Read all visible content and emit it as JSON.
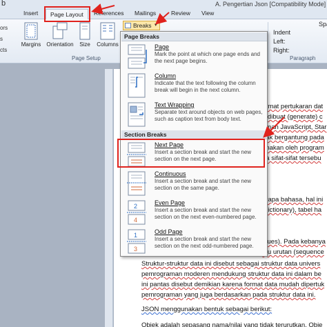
{
  "window": {
    "title": "A. Pengertian Json [Compatibility Mode] -",
    "app_glyph": "b"
  },
  "tabs": [
    {
      "label": "Insert"
    },
    {
      "label": "Page Layout",
      "active": true
    },
    {
      "label": "References"
    },
    {
      "label": "Mailings"
    },
    {
      "label": "Review"
    },
    {
      "label": "View"
    }
  ],
  "left_strip": [
    "ors",
    "s",
    "cts"
  ],
  "ribbon": {
    "margins": "Margins",
    "orientation": "Orientation",
    "size": "Size",
    "columns": "Columns",
    "page_setup": "Page Setup",
    "breaks": "Breaks",
    "indent": "Indent",
    "left": "Left:",
    "right": "Right:",
    "paragraph": "Paragraph",
    "spacing": "Spa"
  },
  "menu": {
    "page_breaks_header": "Page Breaks",
    "section_breaks_header": "Section Breaks",
    "items": [
      {
        "title": "Page",
        "desc": "Mark the point at which one page ends and the next page begins."
      },
      {
        "title": "Column",
        "desc": "Indicate that the text following the column break will begin in the next column."
      },
      {
        "title": "Text Wrapping",
        "desc": "Separate text around objects on web pages, such as caption text from body text."
      },
      {
        "title": "Next Page",
        "desc": "Insert a section break and start the new section on the next page."
      },
      {
        "title": "Continuous",
        "desc": "Insert a section break and start the new section on the same page."
      },
      {
        "title": "Even Page",
        "desc": "Insert a section break and start the new section on the next even-numbered page."
      },
      {
        "title": "Odd Page",
        "desc": "Insert a section break and start the new section on the next odd-numbered page."
      }
    ]
  },
  "document": {
    "lines": [
      "ormat pertukaran dat",
      "n dibuat (generate) c",
      "aman JavaScript, Star",
      "dak bergantung pada",
      "unakan oleh program",
      "na sifat-sifat tersebu",
      "erapa bahasa, hal ini",
      "(dictionary), tabel ha",
      "alues). Pada kebanya",
      "tau urutan (sequence",
      "Struktur-struktur data ini disebut sebagai struktur data univers",
      "pemrograman moderen mendukung struktur data ini dalam be",
      "ini pantas disebut demikian karena format data mudah dipertuk",
      "pemrograman yang juga berdasarkan pada struktur data ini.",
      "JSON menggunakan bentuk sebagai berikut:",
      "Objek adalah sepasang nama/nilai yang tidak terurutkan. Obje"
    ]
  }
}
